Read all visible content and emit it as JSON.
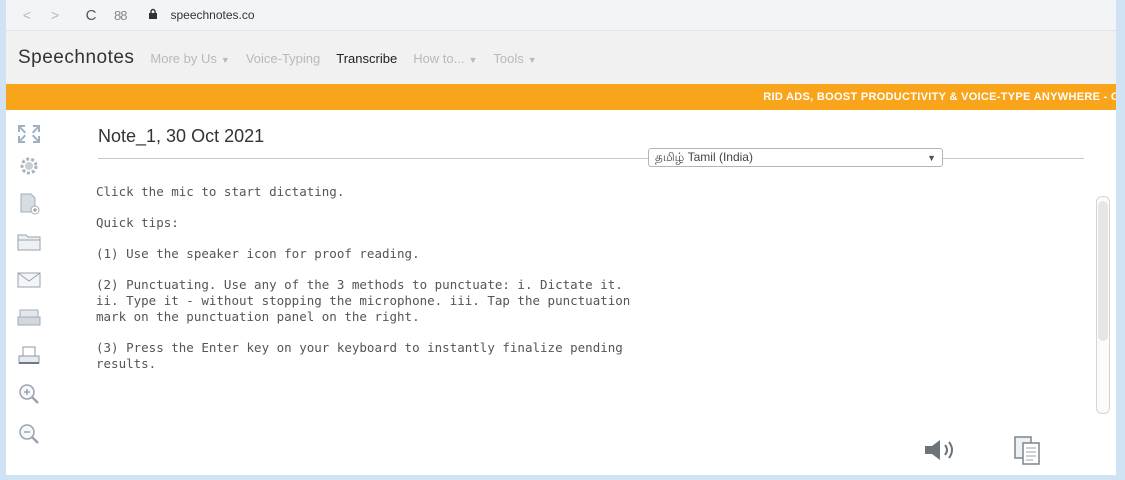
{
  "browser": {
    "back": "<",
    "forward": ">",
    "reload": "C",
    "apps": "88",
    "url": "speechnotes.co"
  },
  "nav": {
    "brand": "Speechnotes",
    "items": [
      {
        "label": "More by Us",
        "dropdown": true
      },
      {
        "label": "Voice-Typing",
        "dropdown": false
      },
      {
        "label": "Transcribe",
        "dropdown": false,
        "active": true
      },
      {
        "label": "How to...",
        "dropdown": true
      },
      {
        "label": "Tools",
        "dropdown": true
      }
    ]
  },
  "banner": {
    "text": "RID ADS, BOOST PRODUCTIVITY & VOICE-TYPE ANYWHERE - CLICK"
  },
  "note": {
    "title": "Note_1, 30 Oct 2021",
    "language": "தமிழ் Tamil (India)",
    "paragraphs": [
      "Click the mic to start dictating.",
      "Quick tips:",
      "(1) Use the speaker icon for proof reading.",
      "(2) Punctuating. Use any of the 3 methods to punctuate: i. Dictate it.\nii. Type it - without stopping the microphone. iii. Tap the punctuation\nmark on the punctuation panel on the right.",
      "(3) Press the Enter key on your keyboard to instantly finalize pending\nresults."
    ]
  },
  "toolbar": {
    "icons": [
      "expand-icon",
      "gear-icon",
      "new-file-icon",
      "folder-icon",
      "mail-icon",
      "print-preview-icon",
      "printer-icon",
      "zoom-in-icon",
      "zoom-out-icon"
    ]
  },
  "colors": {
    "banner": "#f9a51b",
    "frame_bg": "#cfe3f5"
  }
}
